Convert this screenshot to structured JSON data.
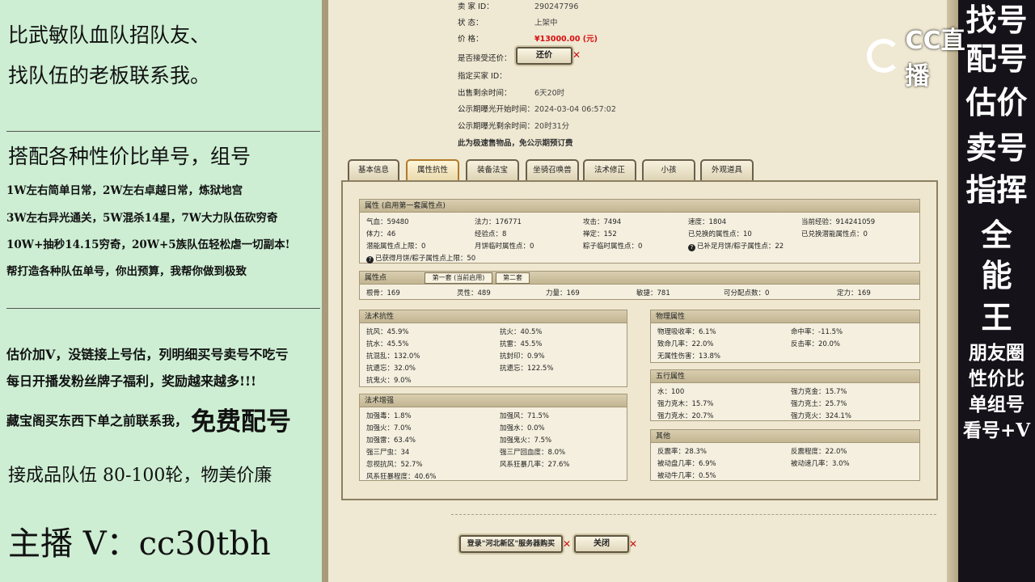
{
  "left_panel": {
    "line1": "比武敏队血队招队友、",
    "line2": "找队伍的老板联系我。",
    "heading": "搭配各种性价比单号，组号",
    "items": [
      "1W左右简单日常，2W左右卓越日常，炼狱地宫",
      "3W左右异光通关，5W混杀14星，7W大力队伍砍穷奇",
      "10W+抽秒14.15穷奇，20W+5族队伍轻松虐一切副本!",
      "帮打造各种队伍单号，你出预算，我帮你做到极致"
    ],
    "line_est": "估价加V，没链接上号估，列明细买号卖号不吃亏",
    "line_daily": "每日开播发粉丝牌子福利，奖励越来越多!!!",
    "line_treasure": "藏宝阁买东西下单之前联系我，",
    "free_match": "免费配号",
    "line_team": "接成品队伍 80-100轮，物美价廉",
    "host": "主播 V：cc30tbh"
  },
  "right_strip": {
    "chars": [
      "找",
      "号",
      "配",
      "号",
      "估",
      "价",
      "卖",
      "号",
      "指",
      "挥",
      "全",
      "能",
      "王"
    ],
    "bottom": [
      "朋友圈",
      "性价比",
      "单组号",
      "看号+V"
    ]
  },
  "logo": {
    "text": "CC直播"
  },
  "seller": {
    "id_label": "卖  家  ID：",
    "id_value": "290247796",
    "status_label": "状      态：",
    "status_value": "上架中",
    "price_label": "价      格：",
    "price_value": "¥13000.00 (元)",
    "counter_label": "是否接受还价：",
    "counter_button": "还价",
    "buyer_label": "指定买家 ID：",
    "remain_label": "出售剩余时间：",
    "remain_value": "6天20时",
    "public_start_label": "公示期曝光开始时间：",
    "public_start_value": "2024-03-04 06:57:02",
    "public_left_label": "公示期曝光剩余时间：",
    "public_left_value": "20时31分",
    "note": "此为极速售物品，免公示期预订费"
  },
  "tabs": [
    "基本信息",
    "属性抗性",
    "装备法宝",
    "坐骑召唤兽",
    "法术修正",
    "小孩",
    "外观道具"
  ],
  "attr": {
    "header": "属性 (启用第一套属性点)",
    "rows": [
      [
        "气血：59480",
        "法力：176771",
        "攻击：7494",
        "速度：1804",
        "当前经验：914241059"
      ],
      [
        "体力：46",
        "经验点：8",
        "禅定：152",
        "已兑换的属性点：10",
        "已兑换潜能属性点：0"
      ],
      [
        "潜能属性点上限：0",
        "月饼临时属性点：0",
        "粽子临时属性点：0",
        "已补足月饼/粽子属性点：22",
        ""
      ]
    ],
    "extra": "已获得月饼/粽子属性点上限：50"
  },
  "points": {
    "header": "属性点",
    "sub1": "第一套 (当前启用)",
    "sub2": "第二套",
    "cells": [
      "根骨：169",
      "灵性：489",
      "力量：169",
      "敏捷：781",
      "可分配点数：0",
      "定力：169"
    ]
  },
  "resist": {
    "header": "法术抗性",
    "cells": [
      "抗风：45.9%",
      "抗火：40.5%",
      "抗水：45.5%",
      "抗雷：45.5%",
      "抗混乱：132.0%",
      "抗封印：0.9%",
      "抗遗忘：32.0%",
      "抗遗忘：122.5%",
      "抗鬼火：9.0%",
      ""
    ]
  },
  "enhance": {
    "header": "法术增强",
    "cells": [
      "加强毒：1.8%",
      "加强风：71.5%",
      "加强火：7.0%",
      "加强水：0.0%",
      "加强雷：63.4%",
      "加强鬼火：7.5%",
      "强三尸虫：34",
      "强三尸回血度：8.0%",
      "忽视抗风：52.7%",
      "风系狂暴几率：27.6%",
      "风系狂暴程度：40.6%",
      ""
    ]
  },
  "physical": {
    "header": "物理属性",
    "cells": [
      "物理吸收率：6.1%",
      "命中率：-11.5%",
      "致命几率：22.0%",
      "反击率：20.0%",
      "无属性伤害：13.8%",
      ""
    ]
  },
  "wuxing": {
    "header": "五行属性",
    "cells": [
      "水：100",
      "强力克金：15.7%",
      "强力克木：15.7%",
      "强力克土：25.7%",
      "强力克水：20.7%",
      "强力克火：324.1%"
    ]
  },
  "other": {
    "header": "其他",
    "cells": [
      "反震率：28.3%",
      "反震程度：22.0%",
      "被动盘几率：6.9%",
      "被动速几率：3.0%",
      "被动牛几率：0.5%",
      ""
    ]
  },
  "bottom_buttons": {
    "login": "登录\"河北新区\"服务器购买",
    "close": "关闭"
  }
}
